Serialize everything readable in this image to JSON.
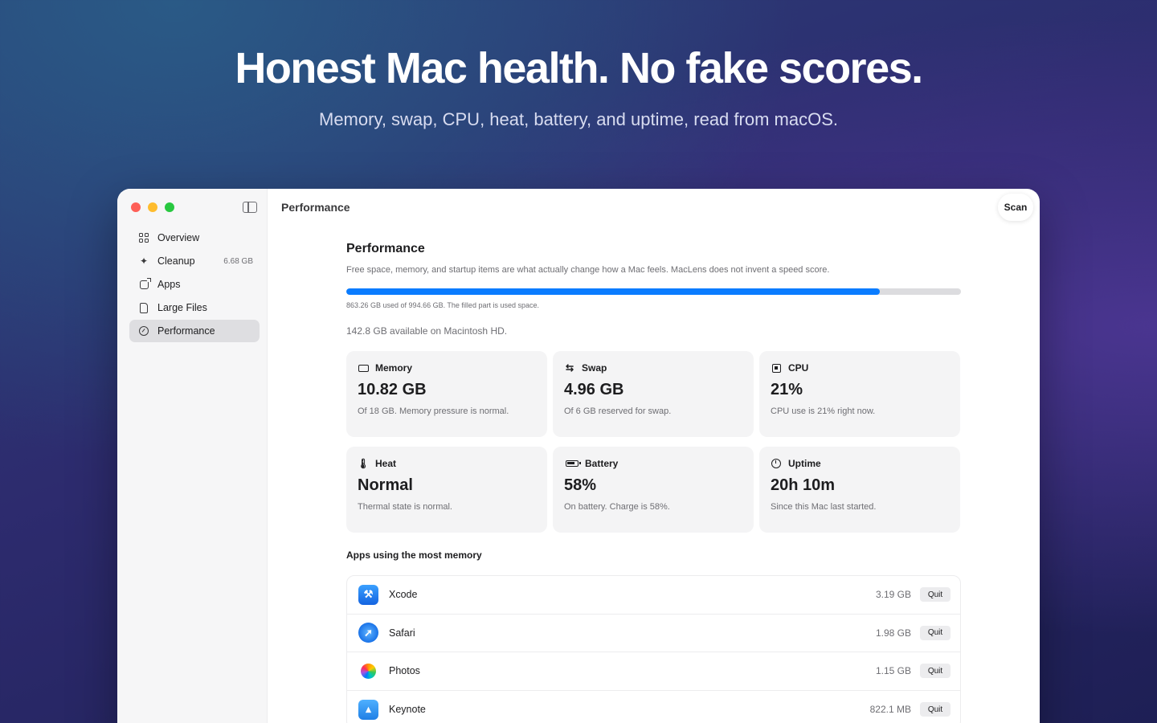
{
  "hero": {
    "headline": "Honest Mac health. No fake scores.",
    "subheadline": "Memory, swap, CPU, heat, battery, and uptime, read from macOS."
  },
  "window": {
    "toolbar_title": "Performance",
    "scan_label": "Scan"
  },
  "sidebar": {
    "items": [
      {
        "label": "Overview",
        "icon": "grid-icon",
        "badge": ""
      },
      {
        "label": "Cleanup",
        "icon": "sparkle-icon",
        "badge": "6.68 GB"
      },
      {
        "label": "Apps",
        "icon": "app-icon",
        "badge": ""
      },
      {
        "label": "Large Files",
        "icon": "document-icon",
        "badge": ""
      },
      {
        "label": "Performance",
        "icon": "gauge-icon",
        "badge": "",
        "active": true
      }
    ]
  },
  "main": {
    "title": "Performance",
    "description": "Free space, memory, and startup items are what actually change how a Mac feels. MacLens does not invent a speed score.",
    "disk": {
      "used_fraction": 0.8677,
      "caption": "863.26 GB used of 994.66 GB. The filled part is used space.",
      "available": "142.8 GB available on Macintosh HD."
    },
    "cards": [
      {
        "label": "Memory",
        "icon": "memory-icon",
        "value": "10.82 GB",
        "note": "Of 18 GB. Memory pressure is normal."
      },
      {
        "label": "Swap",
        "icon": "swap-arrows-icon",
        "value": "4.96 GB",
        "note": "Of 6 GB reserved for swap."
      },
      {
        "label": "CPU",
        "icon": "cpu-chip-icon",
        "value": "21%",
        "note": "CPU use is 21% right now."
      },
      {
        "label": "Heat",
        "icon": "thermometer-icon",
        "value": "Normal",
        "note": "Thermal state is normal."
      },
      {
        "label": "Battery",
        "icon": "battery-icon",
        "value": "58%",
        "note": "On battery. Charge is 58%."
      },
      {
        "label": "Uptime",
        "icon": "clock-icon",
        "value": "20h 10m",
        "note": "Since this Mac last started."
      }
    ],
    "apps_title": "Apps using the most memory",
    "apps": [
      {
        "name": "Xcode",
        "size": "3.19 GB",
        "quit_label": "Quit",
        "icon": "xcode-icon",
        "color": "#1c7cf4"
      },
      {
        "name": "Safari",
        "size": "1.98 GB",
        "quit_label": "Quit",
        "icon": "safari-icon",
        "color": "#2f8bf6"
      },
      {
        "name": "Photos",
        "size": "1.15 GB",
        "quit_label": "Quit",
        "icon": "photos-icon",
        "color": "#ffffff"
      },
      {
        "name": "Keynote",
        "size": "822.1 MB",
        "quit_label": "Quit",
        "icon": "keynote-icon",
        "color": "#2d8ff0"
      }
    ]
  },
  "colors": {
    "accent": "#0a7cff",
    "close": "#fe5f57",
    "minimize": "#febc2e",
    "zoom": "#28c840"
  }
}
